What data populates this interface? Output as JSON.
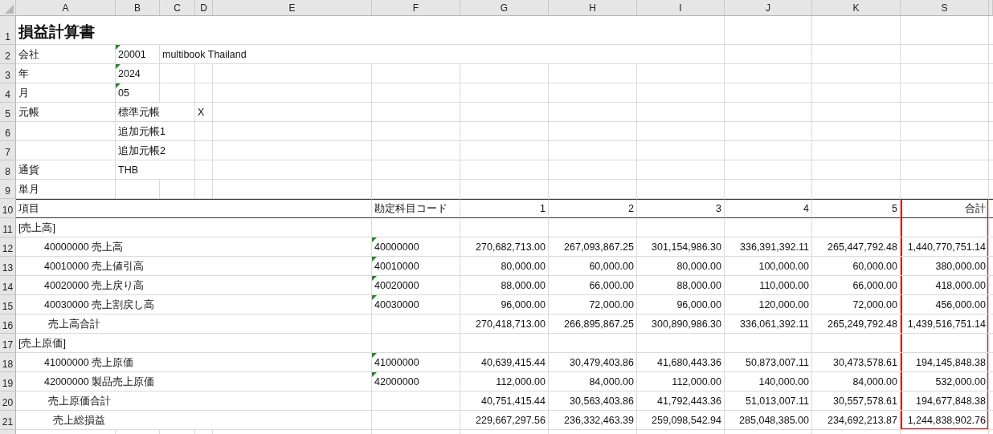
{
  "columns": [
    "A",
    "B",
    "C",
    "D",
    "E",
    "F",
    "G",
    "H",
    "I",
    "J",
    "K",
    "S"
  ],
  "row_headers": [
    "1",
    "2",
    "3",
    "4",
    "5",
    "6",
    "7",
    "8",
    "9",
    "10",
    "11",
    "12",
    "13",
    "14",
    "15",
    "16",
    "17",
    "18",
    "19",
    "20",
    "21"
  ],
  "title": "損益計算書",
  "params": [
    {
      "label": "会社",
      "value": "20001",
      "flagged": true,
      "name": "multibook Thailand"
    },
    {
      "label": "年",
      "value": "2024",
      "flagged": true
    },
    {
      "label": "月",
      "value": "05",
      "flagged": true
    },
    {
      "label": "元帳",
      "value": "標準元帳",
      "flagged": false,
      "mark": "X"
    },
    {
      "value": "追加元帳1",
      "flagged": false
    },
    {
      "value": "追加元帳2",
      "flagged": false
    },
    {
      "label": "通貨",
      "value": "THB",
      "flagged": false
    },
    {
      "label": "単月"
    }
  ],
  "table": {
    "total_column_highlighted": true,
    "header": {
      "item": "項目",
      "account_code": "勘定科目コード",
      "periods": [
        "1",
        "2",
        "3",
        "4",
        "5"
      ],
      "total": "合計"
    },
    "rows": [
      {
        "kind": "section",
        "item": "[売上高]"
      },
      {
        "kind": "account",
        "item": "40000000 売上高",
        "code": "40000000",
        "flagged": true,
        "values": [
          "270,682,713.00",
          "267,093,867.25",
          "301,154,986.30",
          "336,391,392.11",
          "265,447,792.48"
        ],
        "total": "1,440,770,751.14"
      },
      {
        "kind": "account",
        "item": "40010000 売上値引高",
        "code": "40010000",
        "flagged": true,
        "values": [
          "80,000.00",
          "60,000.00",
          "80,000.00",
          "100,000.00",
          "60,000.00"
        ],
        "total": "380,000.00"
      },
      {
        "kind": "account",
        "item": "40020000 売上戻り高",
        "code": "40020000",
        "flagged": true,
        "values": [
          "88,000.00",
          "66,000.00",
          "88,000.00",
          "110,000.00",
          "66,000.00"
        ],
        "total": "418,000.00"
      },
      {
        "kind": "account",
        "item": "40030000 売上割戻し高",
        "code": "40030000",
        "flagged": true,
        "values": [
          "96,000.00",
          "72,000.00",
          "96,000.00",
          "120,000.00",
          "72,000.00"
        ],
        "total": "456,000.00"
      },
      {
        "kind": "subtotal",
        "item": "売上高合計",
        "values": [
          "270,418,713.00",
          "266,895,867.25",
          "300,890,986.30",
          "336,061,392.11",
          "265,249,792.48"
        ],
        "total": "1,439,516,751.14"
      },
      {
        "kind": "section",
        "item": "[売上原価]"
      },
      {
        "kind": "account",
        "item": "41000000 売上原価",
        "code": "41000000",
        "flagged": true,
        "values": [
          "40,639,415.44",
          "30,479,403.86",
          "41,680,443.36",
          "50,873,007.11",
          "30,473,578.61"
        ],
        "total": "194,145,848.38"
      },
      {
        "kind": "account",
        "item": "42000000 製品売上原価",
        "code": "42000000",
        "flagged": true,
        "values": [
          "112,000.00",
          "84,000.00",
          "112,000.00",
          "140,000.00",
          "84,000.00"
        ],
        "total": "532,000.00"
      },
      {
        "kind": "subtotal",
        "item": "売上原価合計",
        "values": [
          "40,751,415.44",
          "30,563,403.86",
          "41,792,443.36",
          "51,013,007.11",
          "30,557,578.61"
        ],
        "total": "194,677,848.38"
      },
      {
        "kind": "total",
        "item": "売上総損益",
        "values": [
          "229,667,297.56",
          "236,332,463.39",
          "259,098,542.94",
          "285,048,385.00",
          "234,692,213.87"
        ],
        "total": "1,244,838,902.76"
      }
    ]
  }
}
